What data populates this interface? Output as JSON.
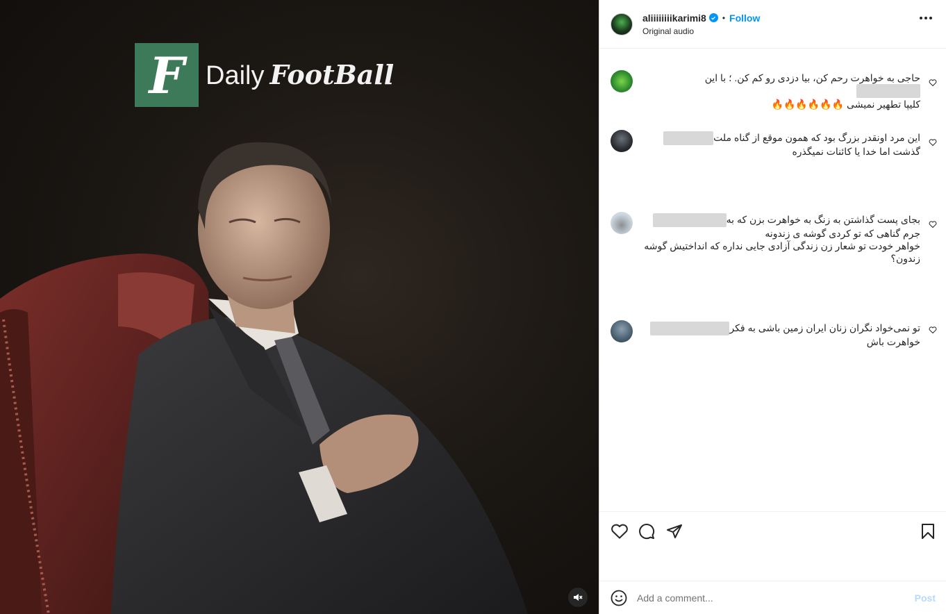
{
  "media": {
    "logo_letter": "F",
    "logo_daily": "Daily",
    "logo_football": "FootBall"
  },
  "header": {
    "username": "aliiiiiiiikarimi8",
    "dot": "•",
    "follow_label": "Follow",
    "audio_label": "Original audio"
  },
  "comments": [
    {
      "line1": "حاجی به خواهرت رحم کن، بیا دزدی رو کم کن. ؛ با این",
      "line2": "کلیپا تطهیر نمیشی 🔥🔥🔥🔥🔥🔥",
      "line3": "",
      "line4": ""
    },
    {
      "line1": "این مرد اونقدر بزرگ بود که همون موقع از گناه ملت",
      "line2": "گذشت اما خدا یا کائنات نمیگذره",
      "line3": "",
      "line4": ""
    },
    {
      "line1": "بجای پست گذاشتن به زنگ به خواهرت بزن که به",
      "line2": "جرم گناهی که تو کردی گوشه ی زندونه",
      "line3": "خواهر خودت تو شعار زن زندگی آزادی جایی نداره که انداختیش گوشه",
      "line4": "زندون؟"
    },
    {
      "line1": "تو نمی‌خواد نگران زنان ایران زمین باشی به فکر",
      "line2": "خواهرت باش",
      "line3": "",
      "line4": ""
    }
  ],
  "add_comment": {
    "placeholder": "Add a comment...",
    "post_label": "Post"
  },
  "icons": [
    "more-icon",
    "verified-icon",
    "heart-icon",
    "comment-icon",
    "share-icon",
    "bookmark-icon",
    "emoji-icon",
    "mute-icon"
  ],
  "colors": {
    "accent": "#0095f6",
    "logo_green": "#3d7a5a"
  }
}
